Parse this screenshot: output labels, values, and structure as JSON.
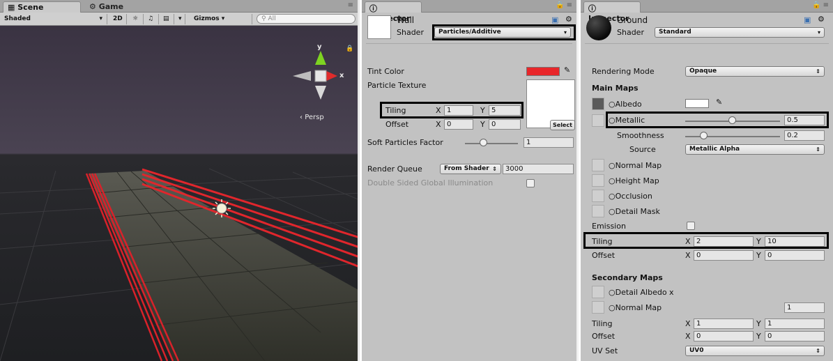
{
  "scene_panel": {
    "tabs": {
      "scene": "Scene",
      "game": "Game"
    },
    "toolbar": {
      "shading": "Shaded",
      "mode_2d": "2D",
      "gizmos": "Gizmos",
      "search_placeholder": "All"
    },
    "gizmo": {
      "y_axis": "y",
      "x_axis": "x",
      "persp": "Persp"
    }
  },
  "inspector_wall": {
    "tab": "Inspector",
    "material_name": "Wall",
    "shader_label": "Shader",
    "shader_value": "Particles/Additive",
    "tint_color_label": "Tint Color",
    "tint_color": "#e8262a",
    "particle_texture_label": "Particle Texture",
    "tiling_label": "Tiling",
    "tiling_x": "1",
    "tiling_y": "5",
    "offset_label": "Offset",
    "offset_x": "0",
    "offset_y": "0",
    "x_label": "X",
    "y_label": "Y",
    "select_label": "Select",
    "soft_particles_label": "Soft Particles Factor",
    "soft_particles_value": "1",
    "soft_particles_level": 0.35,
    "render_queue_label": "Render Queue",
    "render_queue_mode": "From Shader",
    "render_queue_value": "3000",
    "double_sided_label": "Double Sided Global Illumination"
  },
  "inspector_ground": {
    "tab": "Inspector",
    "material_name": "Ground",
    "shader_label": "Shader",
    "shader_value": "Standard",
    "rendering_mode_label": "Rendering Mode",
    "rendering_mode_value": "Opaque",
    "main_maps_label": "Main Maps",
    "albedo_label": "Albedo",
    "metallic_label": "Metallic",
    "metallic_value": "0.5",
    "metallic_level": 0.5,
    "smoothness_label": "Smoothness",
    "smoothness_value": "0.2",
    "smoothness_level": 0.2,
    "source_label": "Source",
    "source_value": "Metallic Alpha",
    "normal_map_label": "Normal Map",
    "height_map_label": "Height Map",
    "occlusion_label": "Occlusion",
    "detail_mask_label": "Detail Mask",
    "emission_label": "Emission",
    "tiling_label": "Tiling",
    "tiling_x": "2",
    "tiling_y": "10",
    "offset_label": "Offset",
    "offset_x": "0",
    "offset_y": "0",
    "x_label": "X",
    "y_label": "Y",
    "secondary_maps_label": "Secondary Maps",
    "detail_albedo_label": "Detail Albedo x",
    "sec_normal_map_label": "Normal Map",
    "sec_normal_value": "1",
    "sec_tiling_label": "Tiling",
    "sec_tiling_x": "1",
    "sec_tiling_y": "1",
    "sec_offset_label": "Offset",
    "sec_offset_x": "0",
    "sec_offset_y": "0",
    "uv_set_label": "UV Set",
    "uv_set_value": "UV0"
  }
}
